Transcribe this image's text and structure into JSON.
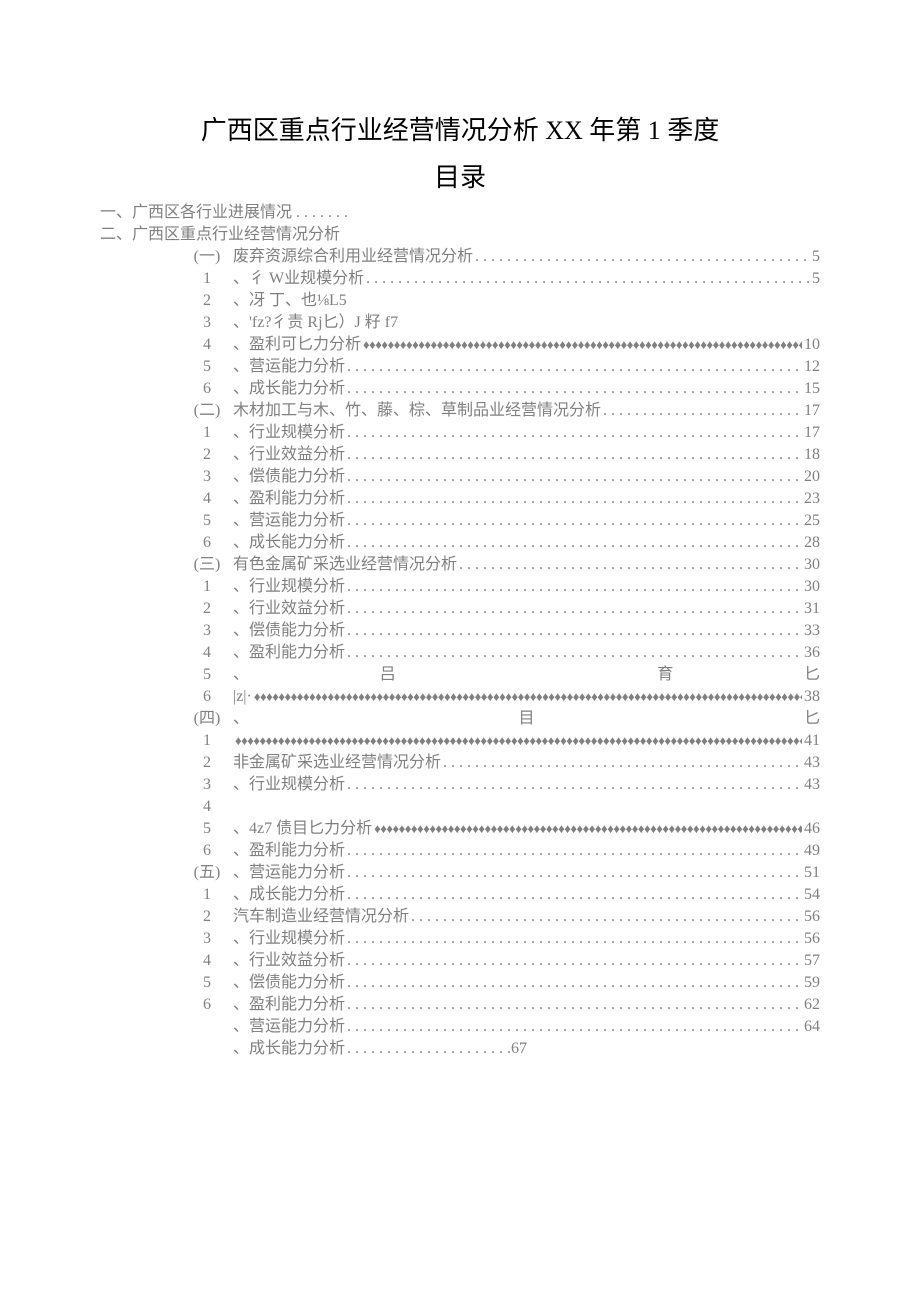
{
  "title": "广西区重点行业经营情况分析 XX 年第 1 季度",
  "subtitle": "目录",
  "topLines": [
    "一、广西区各行业进展情况 . . . . . . .",
    "二、广西区重点行业经营情况分析"
  ],
  "markers": [
    "(一)",
    "1",
    "2",
    "3",
    "4",
    "5",
    "6",
    "(二)",
    "1",
    "2",
    "3",
    "4",
    "5",
    "6",
    "(三)",
    "1",
    "2",
    "3",
    "4",
    "5",
    "6",
    "(四)",
    "1",
    "2",
    "3",
    "4",
    "5",
    "6",
    "(五)",
    "1",
    "2",
    "3",
    "4",
    "5",
    "6"
  ],
  "entries": [
    {
      "text": "废弃资源综合利用业经营情况分析",
      "page": "5",
      "fill": "dots",
      "prefix": ""
    },
    {
      "text": "彳 W业规模分析",
      "page": "5",
      "fill": "dots",
      "prefix": "、"
    },
    {
      "text": "冴 丁、也⅛L5",
      "page": "",
      "fill": "none",
      "prefix": "、"
    },
    {
      "text": "'fz?彳责 Rj匕）J 籽 f7",
      "page": "",
      "fill": "none",
      "prefix": "、"
    },
    {
      "text": "盈利可匕力分析",
      "page": "10",
      "fill": "diamonds",
      "prefix": "、"
    },
    {
      "text": "营运能力分析",
      "page": "12",
      "fill": "dots",
      "prefix": "、"
    },
    {
      "text": "成长能力分析",
      "page": "15",
      "fill": "dots",
      "prefix": "、"
    },
    {
      "text": "木材加工与木、竹、藤、棕、草制品业经营情况分析",
      "page": "17",
      "fill": "dots",
      "prefix": ""
    },
    {
      "text": "行业规模分析",
      "page": "17",
      "fill": "dots",
      "prefix": "、"
    },
    {
      "text": "行业效益分析",
      "page": "18",
      "fill": "dots",
      "prefix": "、"
    },
    {
      "text": "偿债能力分析",
      "page": "20",
      "fill": "dots",
      "prefix": "、"
    },
    {
      "text": "盈利能力分析",
      "page": "23",
      "fill": "dots",
      "prefix": "、"
    },
    {
      "text": "营运能力分析",
      "page": "25",
      "fill": "dots",
      "prefix": "、"
    },
    {
      "text": "成长能力分析",
      "page": "28",
      "fill": "dots",
      "prefix": "、"
    },
    {
      "text": "有色金属矿采选业经营情况分析",
      "page": "30",
      "fill": "dots",
      "prefix": ""
    },
    {
      "text": "行业规模分析",
      "page": "30",
      "fill": "dots",
      "prefix": "、"
    },
    {
      "text": "行业效益分析",
      "page": "31",
      "fill": "dots",
      "prefix": "、"
    },
    {
      "text": "偿债能力分析",
      "page": "33",
      "fill": "dots",
      "prefix": "、"
    },
    {
      "text": "盈利能力分析",
      "page": "36",
      "fill": "dots",
      "prefix": "、"
    },
    {
      "spread": {
        "left": "、",
        "mids": [
          "吕",
          "育"
        ],
        "right": "匕"
      }
    },
    {
      "text": "|z|·",
      "page": "38",
      "fill": "diamonds",
      "prefix": ""
    },
    {
      "spread": {
        "left": "、",
        "mids": [
          "目"
        ],
        "right": "匕"
      }
    },
    {
      "text": "",
      "page": "41",
      "fill": "diamonds",
      "prefix": ""
    },
    {
      "text": "非金属矿采选业经营情况分析",
      "page": "43",
      "fill": "dots",
      "prefix": ""
    },
    {
      "text": "行业规模分析",
      "page": "43",
      "fill": "dots",
      "prefix": "、"
    },
    {
      "text": "",
      "page": "",
      "fill": "none",
      "prefix": ""
    },
    {
      "text": "4z7 债目匕力分析",
      "page": "46",
      "fill": "diamonds",
      "prefix": "、"
    },
    {
      "text": "盈利能力分析",
      "page": "49",
      "fill": "dots",
      "prefix": "、"
    },
    {
      "text": "营运能力分析",
      "page": "51",
      "fill": "dots",
      "prefix": "、"
    },
    {
      "text": "成长能力分析",
      "page": "54",
      "fill": "dots",
      "prefix": "、"
    },
    {
      "text": "汽车制造业经营情况分析",
      "page": "56",
      "fill": "dots",
      "prefix": ""
    },
    {
      "text": "行业规模分析",
      "page": "56",
      "fill": "dots",
      "prefix": "、"
    },
    {
      "text": "行业效益分析",
      "page": "57",
      "fill": "dots",
      "prefix": "、"
    },
    {
      "text": "偿债能力分析",
      "page": "59",
      "fill": "dots",
      "prefix": "、"
    },
    {
      "text": "盈利能力分析",
      "page": "62",
      "fill": "dots",
      "prefix": "、"
    },
    {
      "text": "营运能力分析",
      "page": "64",
      "fill": "dots",
      "prefix": "、"
    },
    {
      "text": "成长能力分析",
      "page": "67",
      "fill": "dots-short",
      "prefix": "、"
    }
  ],
  "dotsFill": ". . . . . . . . . . . . . . . . . . . . . . . . . . . . . . . . . . . . . . . . . . . . . . . . . . . . . . . . . . . . . . . . . . . . . . . . . . . . . . . . . . . . . . . . . . .",
  "dotsShort": " . . . . . . . . . . . . . . . . . . . . . ",
  "diamondsFill": "♦♦♦♦♦♦♦♦♦♦♦♦♦♦♦♦♦♦♦♦♦♦♦♦♦♦♦♦♦♦♦♦♦♦♦♦♦♦♦♦♦♦♦♦♦♦♦♦♦♦♦♦♦♦♦♦♦♦♦♦♦♦♦♦♦♦♦♦♦♦♦♦♦♦♦♦♦♦♦♦♦♦♦♦♦♦♦♦♦♦♦♦♦♦♦♦♦♦♦♦♦"
}
